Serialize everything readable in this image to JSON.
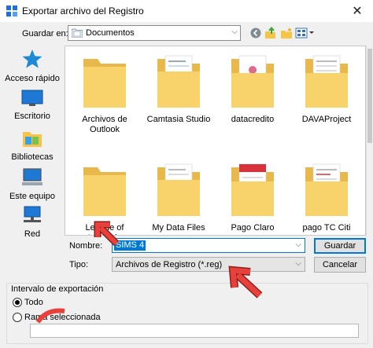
{
  "window": {
    "title": "Exportar archivo del Registro",
    "close_glyph": "✕",
    "icon": "registry-editor-icon"
  },
  "toolbar": {
    "save_in_label": "Guardar en:",
    "location": "Documentos",
    "icons": [
      "back-icon",
      "up-folder-icon",
      "new-folder-icon",
      "view-menu-icon"
    ]
  },
  "places": [
    {
      "label": "Acceso rápido",
      "icon": "star-icon"
    },
    {
      "label": "Escritorio",
      "icon": "desktop-icon"
    },
    {
      "label": "Bibliotecas",
      "icon": "libraries-icon"
    },
    {
      "label": "Este equipo",
      "icon": "computer-icon"
    },
    {
      "label": "Red",
      "icon": "network-icon"
    }
  ],
  "files": [
    {
      "name": "Archivos de Outlook",
      "preview": "empty"
    },
    {
      "name": "Camtasia Studio",
      "preview": "doc"
    },
    {
      "name": "datacredito",
      "preview": "doc"
    },
    {
      "name": "DAVAProject",
      "preview": "doc"
    },
    {
      "name": "League of Legends",
      "preview": "empty"
    },
    {
      "name": "My Data Files",
      "preview": "doc"
    },
    {
      "name": "Pago Claro",
      "preview": "red"
    },
    {
      "name": "pago TC Citi",
      "preview": "doc"
    }
  ],
  "form": {
    "name_label": "Nombre:",
    "name_value": "SIMS 4",
    "type_label": "Tipo:",
    "type_value": "Archivos de Registro (*.reg)",
    "save_button": "Guardar",
    "cancel_button": "Cancelar"
  },
  "export_range": {
    "title": "Intervalo de exportación",
    "all_label": "Todo",
    "branch_label": "Rama seleccionada",
    "selected": "Todo",
    "branch_value": ""
  },
  "colors": {
    "accent": "#0078d7",
    "folder": "#f8d26a",
    "annotation_arrow": "#e8403a"
  }
}
